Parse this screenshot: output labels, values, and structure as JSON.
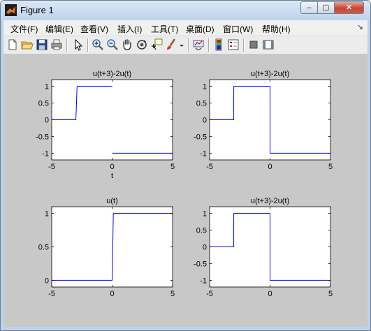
{
  "window": {
    "title": "Figure 1"
  },
  "window_controls": {
    "minimize": "–",
    "maximize": "▢",
    "close": "✕"
  },
  "menu": {
    "items": [
      "文件(F)",
      "编辑(E)",
      "查看(V)",
      "插入(I)",
      "工具(T)",
      "桌面(D)",
      "窗口(W)",
      "帮助(H)"
    ],
    "dock_arrow": "↘"
  },
  "toolbar": {
    "icons": [
      "new-figure-icon",
      "open-file-icon",
      "save-icon",
      "print-icon",
      "edit-plot-arrow-icon",
      "zoom-in-icon",
      "zoom-out-icon",
      "pan-hand-icon",
      "rotate-3d-icon",
      "data-cursor-icon",
      "brush-icon",
      "brush-dropdown-icon",
      "link-plot-icon",
      "insert-colorbar-icon",
      "insert-legend-icon",
      "hide-plot-tools-icon",
      "show-plot-tools-icon"
    ]
  },
  "colors": {
    "line": "#0000ff",
    "figure_bg": "#c8c8c8",
    "axes_bg": "#ffffff"
  },
  "chart_data": [
    {
      "type": "line",
      "title": "u(t+3)-2u(t)",
      "xlabel": "t",
      "xlim": [
        -5,
        5
      ],
      "ylim": [
        -1.2,
        1.2
      ],
      "xticks": [
        -5,
        0,
        5
      ],
      "xticklabels": [
        "-5",
        "0",
        "5"
      ],
      "yticks": [
        1,
        0.5,
        0,
        -0.5,
        -1
      ],
      "yticklabels": [
        "1",
        "0.5",
        "0",
        "-0.5",
        "-1"
      ],
      "series": [
        {
          "x": [
            -5,
            -3,
            -2.9
          ],
          "y": [
            0,
            0,
            1
          ]
        },
        {
          "x": [
            -2.9,
            0
          ],
          "y": [
            1,
            1
          ]
        },
        {
          "x": [
            0,
            5
          ],
          "y": [
            -1,
            -1
          ]
        }
      ]
    },
    {
      "type": "line",
      "title": "u(t+3)-2u(t)",
      "xlabel": "",
      "xlim": [
        -5,
        5
      ],
      "ylim": [
        -1.2,
        1.2
      ],
      "xticks": [
        -5,
        0,
        5
      ],
      "xticklabels": [
        "-5",
        "0",
        "5"
      ],
      "yticks": [
        1,
        0.5,
        0,
        -0.5,
        -1
      ],
      "yticklabels": [
        "1",
        "0.5",
        "0",
        "-0.5",
        "-1"
      ],
      "series": [
        {
          "x": [
            -5,
            -3,
            -3,
            0,
            0,
            5
          ],
          "y": [
            0,
            0,
            1,
            1,
            -1,
            -1
          ]
        }
      ]
    },
    {
      "type": "line",
      "title": "u(t)",
      "xlabel": "",
      "xlim": [
        -5,
        5
      ],
      "ylim": [
        -0.1,
        1.1
      ],
      "xticks": [
        -5,
        0,
        5
      ],
      "xticklabels": [
        "-5",
        "0",
        "5"
      ],
      "yticks": [
        1,
        0.5,
        0
      ],
      "yticklabels": [
        "1",
        "0.5",
        "0"
      ],
      "series": [
        {
          "x": [
            -5,
            0,
            0.1,
            5
          ],
          "y": [
            0,
            0,
            1,
            1
          ]
        }
      ]
    },
    {
      "type": "line",
      "title": "u(t+3)-2u(t)",
      "xlabel": "",
      "xlim": [
        -5,
        5
      ],
      "ylim": [
        -1.2,
        1.2
      ],
      "xticks": [
        -5,
        0,
        5
      ],
      "xticklabels": [
        "-5",
        "0",
        "5"
      ],
      "yticks": [
        1,
        0.5,
        0,
        -0.5,
        -1
      ],
      "yticklabels": [
        "1",
        "0.5",
        "0",
        "-0.5",
        "-1"
      ],
      "series": [
        {
          "x": [
            -5,
            -3,
            -3,
            0,
            0,
            5
          ],
          "y": [
            0,
            0,
            1,
            1,
            -1,
            -1
          ]
        }
      ]
    }
  ]
}
